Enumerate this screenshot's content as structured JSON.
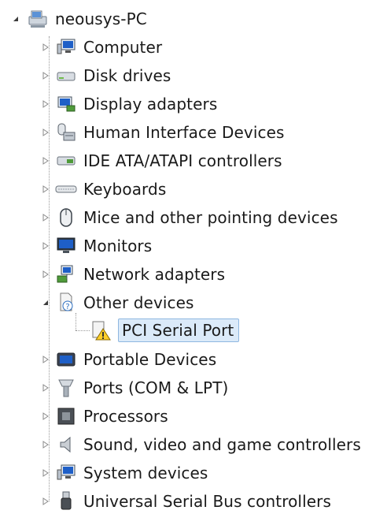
{
  "root": {
    "label": "neousys-PC",
    "icon": "computer-network-icon"
  },
  "categories": [
    {
      "key": "computer",
      "label": "Computer",
      "icon": "computer-icon",
      "expanded": false
    },
    {
      "key": "disk",
      "label": "Disk drives",
      "icon": "disk-drive-icon",
      "expanded": false
    },
    {
      "key": "display",
      "label": "Display adapters",
      "icon": "display-adapter-icon",
      "expanded": false
    },
    {
      "key": "hid",
      "label": "Human Interface Devices",
      "icon": "hid-icon",
      "expanded": false
    },
    {
      "key": "ide",
      "label": "IDE ATA/ATAPI controllers",
      "icon": "ide-controller-icon",
      "expanded": false
    },
    {
      "key": "keyboards",
      "label": "Keyboards",
      "icon": "keyboard-icon",
      "expanded": false
    },
    {
      "key": "mice",
      "label": "Mice and other pointing devices",
      "icon": "mouse-icon",
      "expanded": false
    },
    {
      "key": "monitors",
      "label": "Monitors",
      "icon": "monitor-icon",
      "expanded": false
    },
    {
      "key": "network",
      "label": "Network adapters",
      "icon": "network-adapter-icon",
      "expanded": false
    },
    {
      "key": "other",
      "label": "Other devices",
      "icon": "unknown-device-icon",
      "expanded": true,
      "children": [
        {
          "label": "PCI Serial Port",
          "icon": "warning-device-icon",
          "selected": true
        }
      ]
    },
    {
      "key": "portable",
      "label": "Portable Devices",
      "icon": "portable-device-icon",
      "expanded": false
    },
    {
      "key": "ports",
      "label": "Ports (COM & LPT)",
      "icon": "port-icon",
      "expanded": false
    },
    {
      "key": "processors",
      "label": "Processors",
      "icon": "processor-icon",
      "expanded": false
    },
    {
      "key": "sound",
      "label": "Sound, video and game controllers",
      "icon": "speaker-icon",
      "expanded": false
    },
    {
      "key": "system",
      "label": "System devices",
      "icon": "system-device-icon",
      "expanded": false
    },
    {
      "key": "usb",
      "label": "Universal Serial Bus controllers",
      "icon": "usb-icon",
      "expanded": false
    }
  ],
  "colors": {
    "selection_bg": "#dbeaf9",
    "selection_border": "#8fb7e0",
    "tree_line": "#9a9a9a"
  }
}
